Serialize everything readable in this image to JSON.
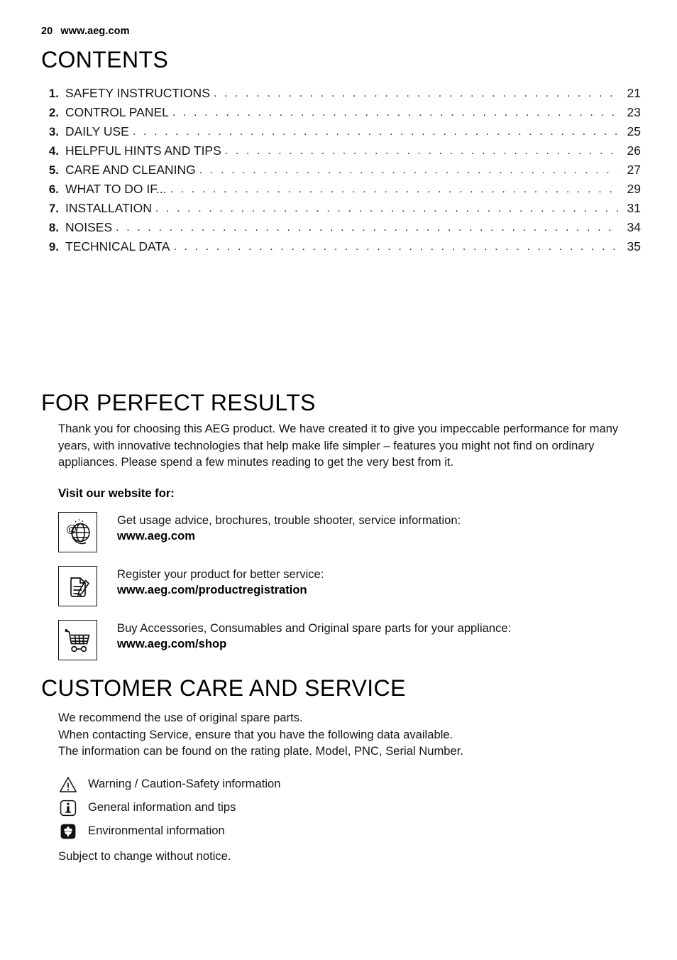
{
  "header": {
    "page_number": "20",
    "website": "www.aeg.com"
  },
  "contents": {
    "heading": "CONTENTS",
    "items": [
      {
        "num": "1.",
        "label": "SAFETY INSTRUCTIONS",
        "page": "21"
      },
      {
        "num": "2.",
        "label": "CONTROL PANEL",
        "page": "23"
      },
      {
        "num": "3.",
        "label": "DAILY USE",
        "page": "25"
      },
      {
        "num": "4.",
        "label": "HELPFUL HINTS AND TIPS",
        "page": "26"
      },
      {
        "num": "5.",
        "label": "CARE AND CLEANING",
        "page": "27"
      },
      {
        "num": "6.",
        "label": "WHAT TO DO IF...",
        "page": "29"
      },
      {
        "num": "7.",
        "label": "INSTALLATION",
        "page": "31"
      },
      {
        "num": "8.",
        "label": "NOISES",
        "page": "34"
      },
      {
        "num": "9.",
        "label": "TECHNICAL DATA",
        "page": "35"
      }
    ],
    "leader": ". . . . . . . . . . . . . . . . . . . . . . . . . . . . . . . . . . . . . . . . . . . . . . . . . . . . . . . . . . . . . . . . . . . . . . . . . . . . . . . . . . . . . . . . . . . . . . ."
  },
  "perfect_results": {
    "heading": "FOR PERFECT RESULTS",
    "paragraph": "Thank you for choosing this AEG product. We have created it to give you impeccable performance for many years, with innovative technologies that help make life simpler – features you might not find on ordinary appliances. Please spend a few minutes reading to get the very best from it.",
    "visit_label": "Visit our website for:",
    "rows": [
      {
        "icon": "globe-at-icon",
        "description": "Get usage advice, brochures, trouble shooter, service information:",
        "url": "www.aeg.com"
      },
      {
        "icon": "document-pen-icon",
        "description": "Register your product for better service:",
        "url": "www.aeg.com/productregistration"
      },
      {
        "icon": "shopping-cart-icon",
        "description": "Buy Accessories, Consumables and Original spare parts for your appliance:",
        "url": "www.aeg.com/shop"
      }
    ]
  },
  "customer_care": {
    "heading": "CUSTOMER CARE AND SERVICE",
    "lines": [
      "We recommend the use of original spare parts.",
      "When contacting Service, ensure that you have the following data available.",
      "The information can be found on the rating plate. Model, PNC, Serial Number."
    ],
    "legend": [
      {
        "icon": "warning-triangle-icon",
        "label": "Warning / Caution-Safety information"
      },
      {
        "icon": "info-square-icon",
        "label": "General information and tips"
      },
      {
        "icon": "environment-flower-icon",
        "label": "Environmental information"
      }
    ],
    "subject_note": "Subject to change without notice."
  },
  "colors": {
    "text": "#000000",
    "background": "#ffffff"
  }
}
